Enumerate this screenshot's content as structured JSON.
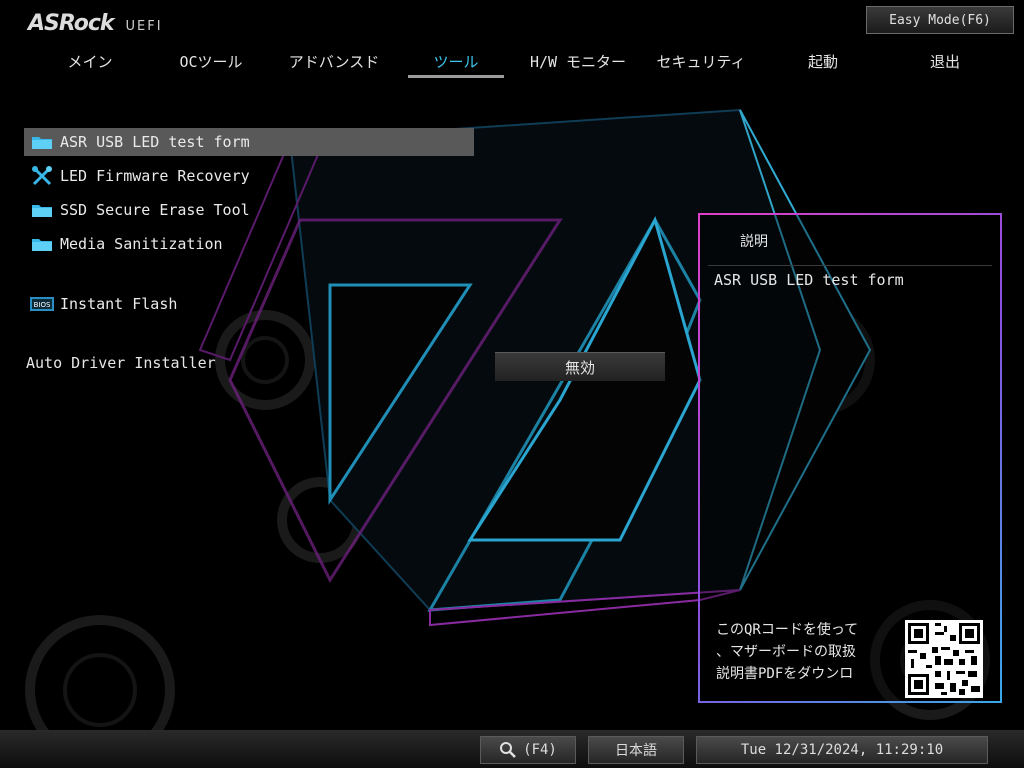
{
  "header": {
    "brand": "ASRock",
    "uefi_label": "UEFI",
    "easy_mode_label": "Easy Mode(F6)"
  },
  "tabs": [
    {
      "label": "メイン"
    },
    {
      "label": "OCツール"
    },
    {
      "label": "アドバンスド"
    },
    {
      "label": "ツール",
      "active": true
    },
    {
      "label": "H/W モニター"
    },
    {
      "label": "セキュリティ"
    },
    {
      "label": "起動"
    },
    {
      "label": "退出"
    }
  ],
  "menu": {
    "items": [
      {
        "label": "ASR USB LED test form",
        "icon": "folder-icon",
        "selected": true
      },
      {
        "label": "LED Firmware Recovery",
        "icon": "tools-icon"
      },
      {
        "label": "SSD Secure Erase Tool",
        "icon": "folder-icon"
      },
      {
        "label": "Media Sanitization",
        "icon": "folder-icon"
      },
      {
        "label": "Instant Flash",
        "icon": "bios-icon"
      }
    ]
  },
  "settings": {
    "auto_driver": {
      "label": "Auto Driver Installer",
      "value": "無効"
    }
  },
  "description": {
    "title": "説明",
    "text": "ASR USB LED test form",
    "qr_lines": [
      "このQRコードを使って",
      "、マザーボードの取扱",
      "説明書PDFをダウンロ"
    ]
  },
  "bottom": {
    "search_label": "(F4)",
    "language": "日本語",
    "datetime": "Tue 12/31/2024, 11:29:10"
  },
  "colors": {
    "accent": "#3fc6ee",
    "selected_row": "#595959",
    "panel_border_start": "#e040c8",
    "panel_border_end": "#3aa8e8"
  }
}
